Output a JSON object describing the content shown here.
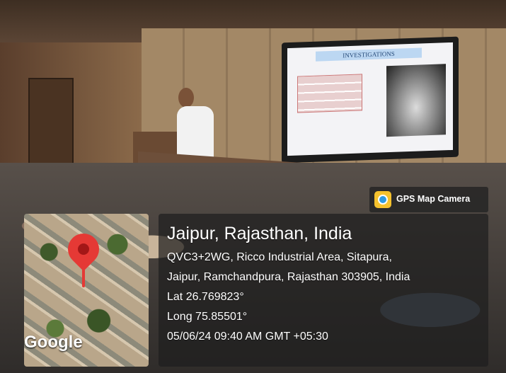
{
  "photo": {
    "slide_title": "INVESTIGATIONS"
  },
  "badge": {
    "label": "GPS Map Camera",
    "icon": "gps-map-camera-icon",
    "bg_color": "#232323"
  },
  "map": {
    "logo": "Google",
    "pin_icon": "location-pin-icon",
    "pin_color": "#e53935"
  },
  "location": {
    "title": "Jaipur, Rajasthan, India",
    "address_line1": "QVC3+2WG, Ricco Industrial Area, Sitapura,",
    "address_line2": "Jaipur, Ramchandpura, Rajasthan 303905, India",
    "lat": "Lat 26.769823°",
    "long": "Long 75.85501°",
    "datetime": "05/06/24 09:40 AM GMT +05:30"
  }
}
